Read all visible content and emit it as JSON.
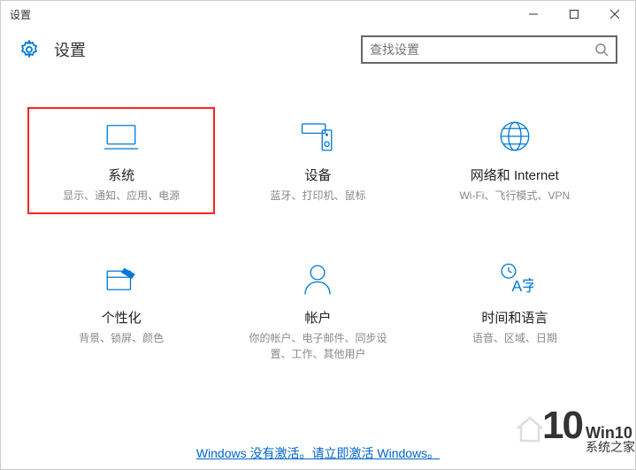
{
  "window": {
    "title": "设置"
  },
  "header": {
    "title": "设置"
  },
  "search": {
    "placeholder": "查找设置"
  },
  "categories": [
    {
      "title": "系统",
      "desc": "显示、通知、应用、电源"
    },
    {
      "title": "设备",
      "desc": "蓝牙、打印机、鼠标"
    },
    {
      "title": "网络和 Internet",
      "desc": "Wi-Fi、飞行模式、VPN"
    },
    {
      "title": "个性化",
      "desc": "背景、锁屏、颜色"
    },
    {
      "title": "帐户",
      "desc": "你的帐户、电子邮件、同步设置、工作、其他用户"
    },
    {
      "title": "时间和语言",
      "desc": "语音、区域、日期"
    }
  ],
  "activate": {
    "text": "Windows 没有激活。请立即激活 Windows。"
  },
  "watermark": {
    "big": "10",
    "top": "Win10",
    "bottom": "系统之家"
  }
}
